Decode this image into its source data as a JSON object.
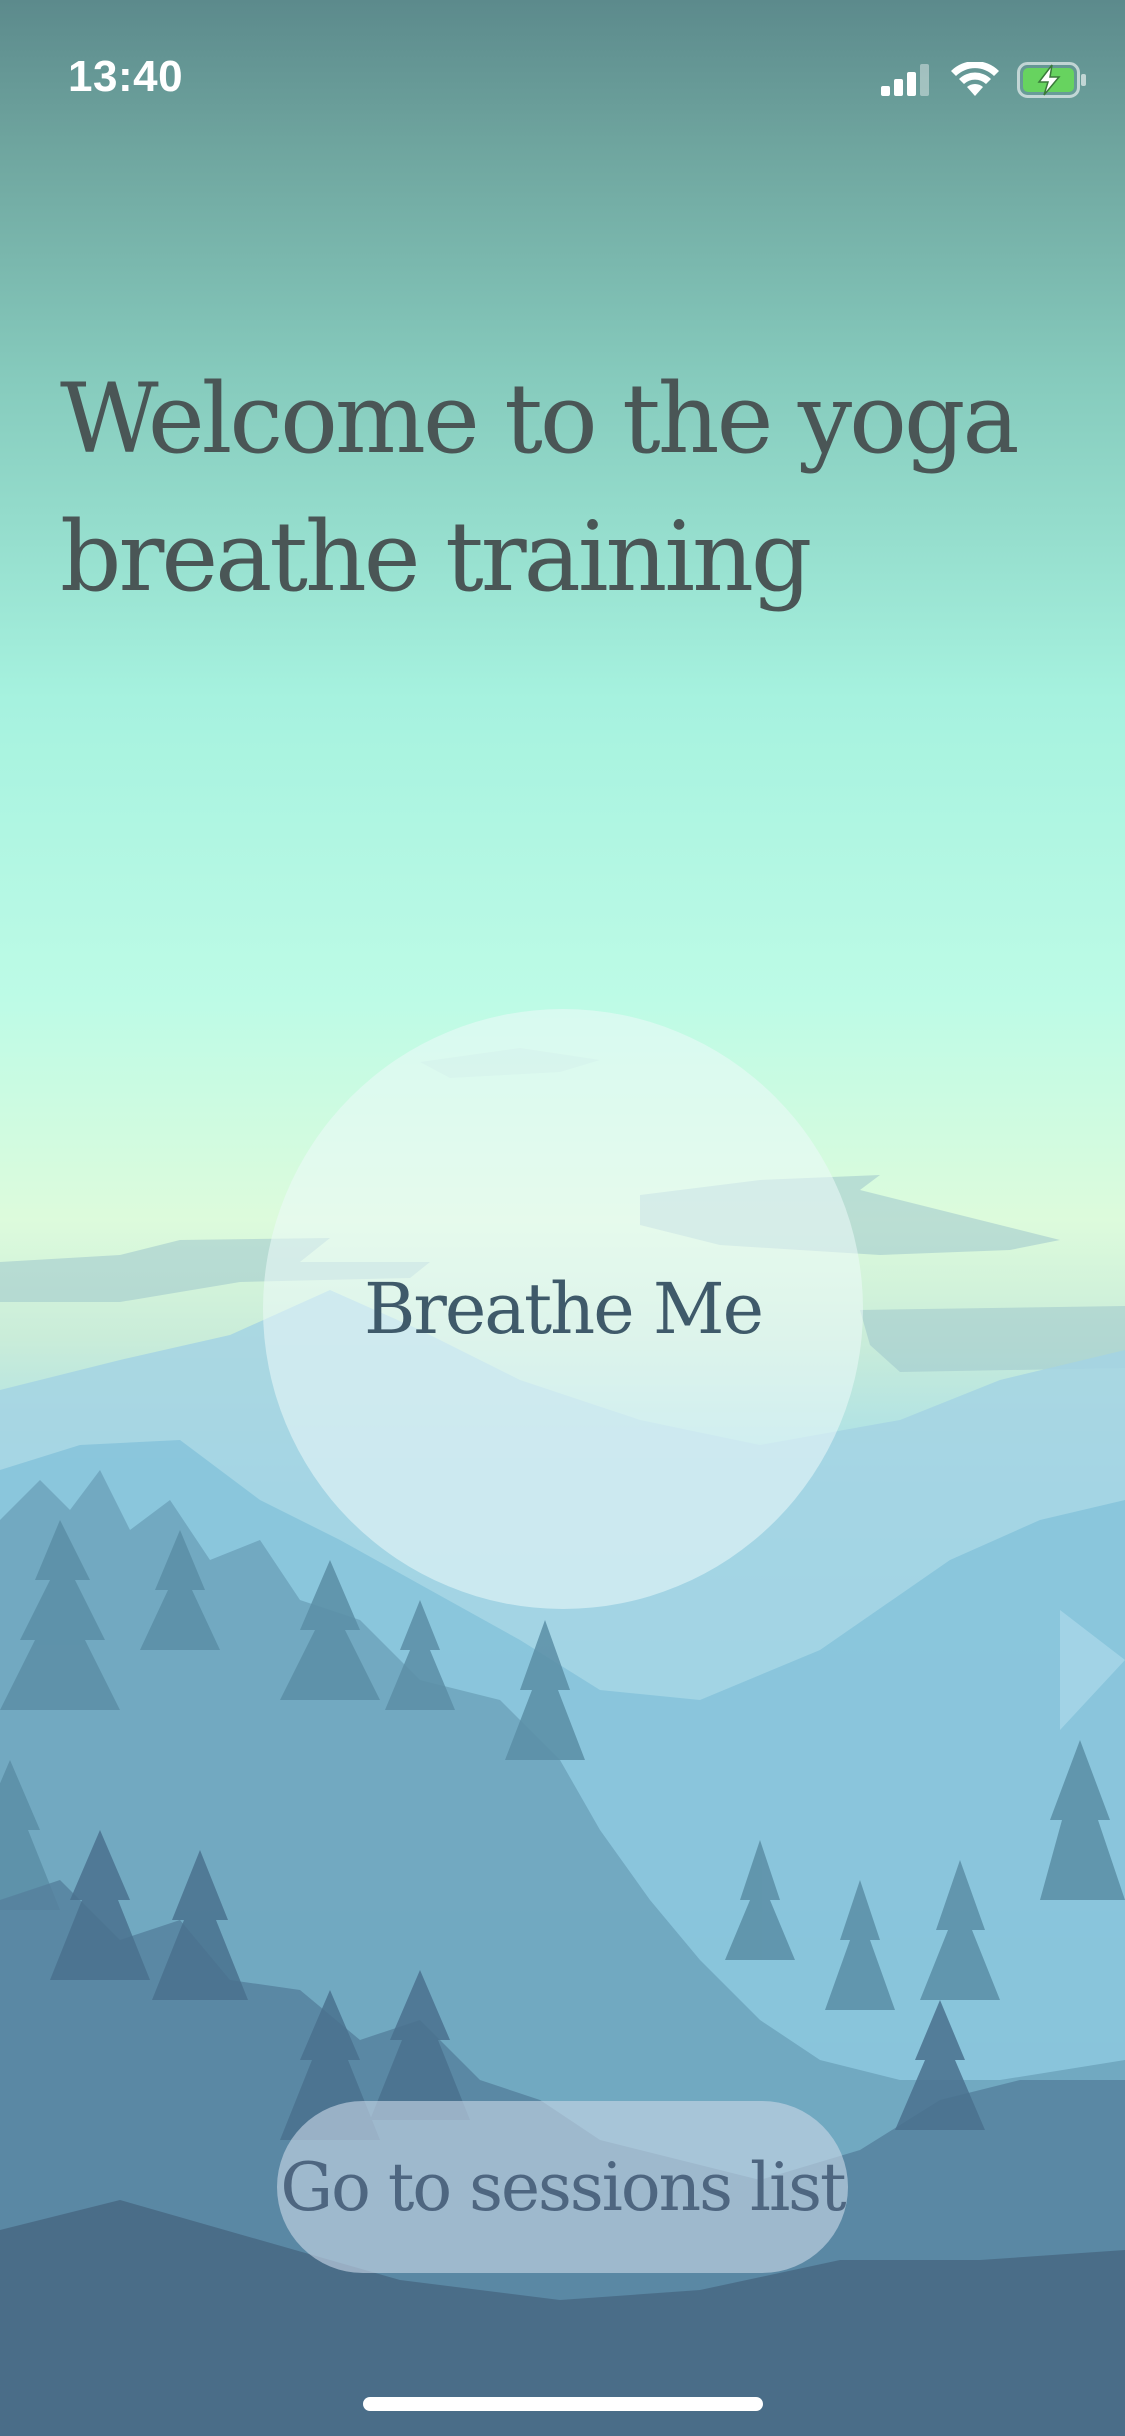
{
  "status_bar": {
    "time": "13:40",
    "icons": [
      "cellular-signal-icon",
      "wifi-icon",
      "battery-charging-icon"
    ]
  },
  "welcome": {
    "title": "Welcome to the yoga breathe training"
  },
  "breathe_button": {
    "label": "Breathe Me"
  },
  "sessions_button": {
    "label": "Go to sessions list"
  },
  "colors": {
    "title_text": "#4a5656",
    "breathe_text": "#3f5a6a",
    "sessions_text": "#4e6680",
    "battery_fill": "#67d35f"
  }
}
